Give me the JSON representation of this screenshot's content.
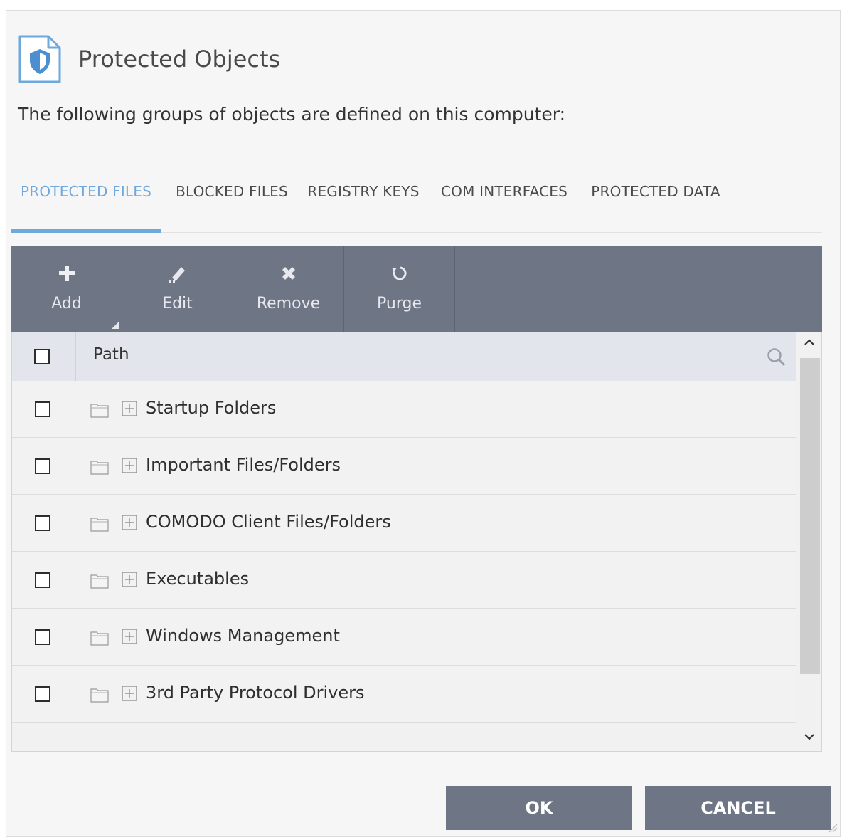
{
  "dialog": {
    "title": "Protected Objects",
    "description": "The following groups of objects are defined on this computer:"
  },
  "tabs": [
    {
      "label": "PROTECTED FILES",
      "active": true
    },
    {
      "label": "BLOCKED FILES",
      "active": false
    },
    {
      "label": "REGISTRY KEYS",
      "active": false
    },
    {
      "label": "COM INTERFACES",
      "active": false
    },
    {
      "label": "PROTECTED DATA",
      "active": false
    }
  ],
  "toolbar": {
    "add_label": "Add",
    "edit_label": "Edit",
    "remove_label": "Remove",
    "purge_label": "Purge"
  },
  "table": {
    "path_header": "Path",
    "rows": [
      {
        "name": "Startup Folders",
        "checked": false
      },
      {
        "name": "Important Files/Folders",
        "checked": false
      },
      {
        "name": "COMODO Client Files/Folders",
        "checked": false
      },
      {
        "name": "Executables",
        "checked": false
      },
      {
        "name": "Windows Management",
        "checked": false
      },
      {
        "name": "3rd Party Protocol Drivers",
        "checked": false
      }
    ]
  },
  "footer": {
    "ok_label": "OK",
    "cancel_label": "CANCEL"
  },
  "colors": {
    "accent": "#6fa8dc",
    "toolbar": "#6e7585",
    "button": "#6e7585"
  },
  "icons": [
    "shield-document-icon",
    "plus-icon",
    "pencil-icon",
    "x-icon",
    "refresh-icon",
    "search-icon",
    "folder-icon",
    "expand-icon",
    "chevron-up-icon",
    "chevron-down-icon",
    "resize-grip-icon"
  ]
}
